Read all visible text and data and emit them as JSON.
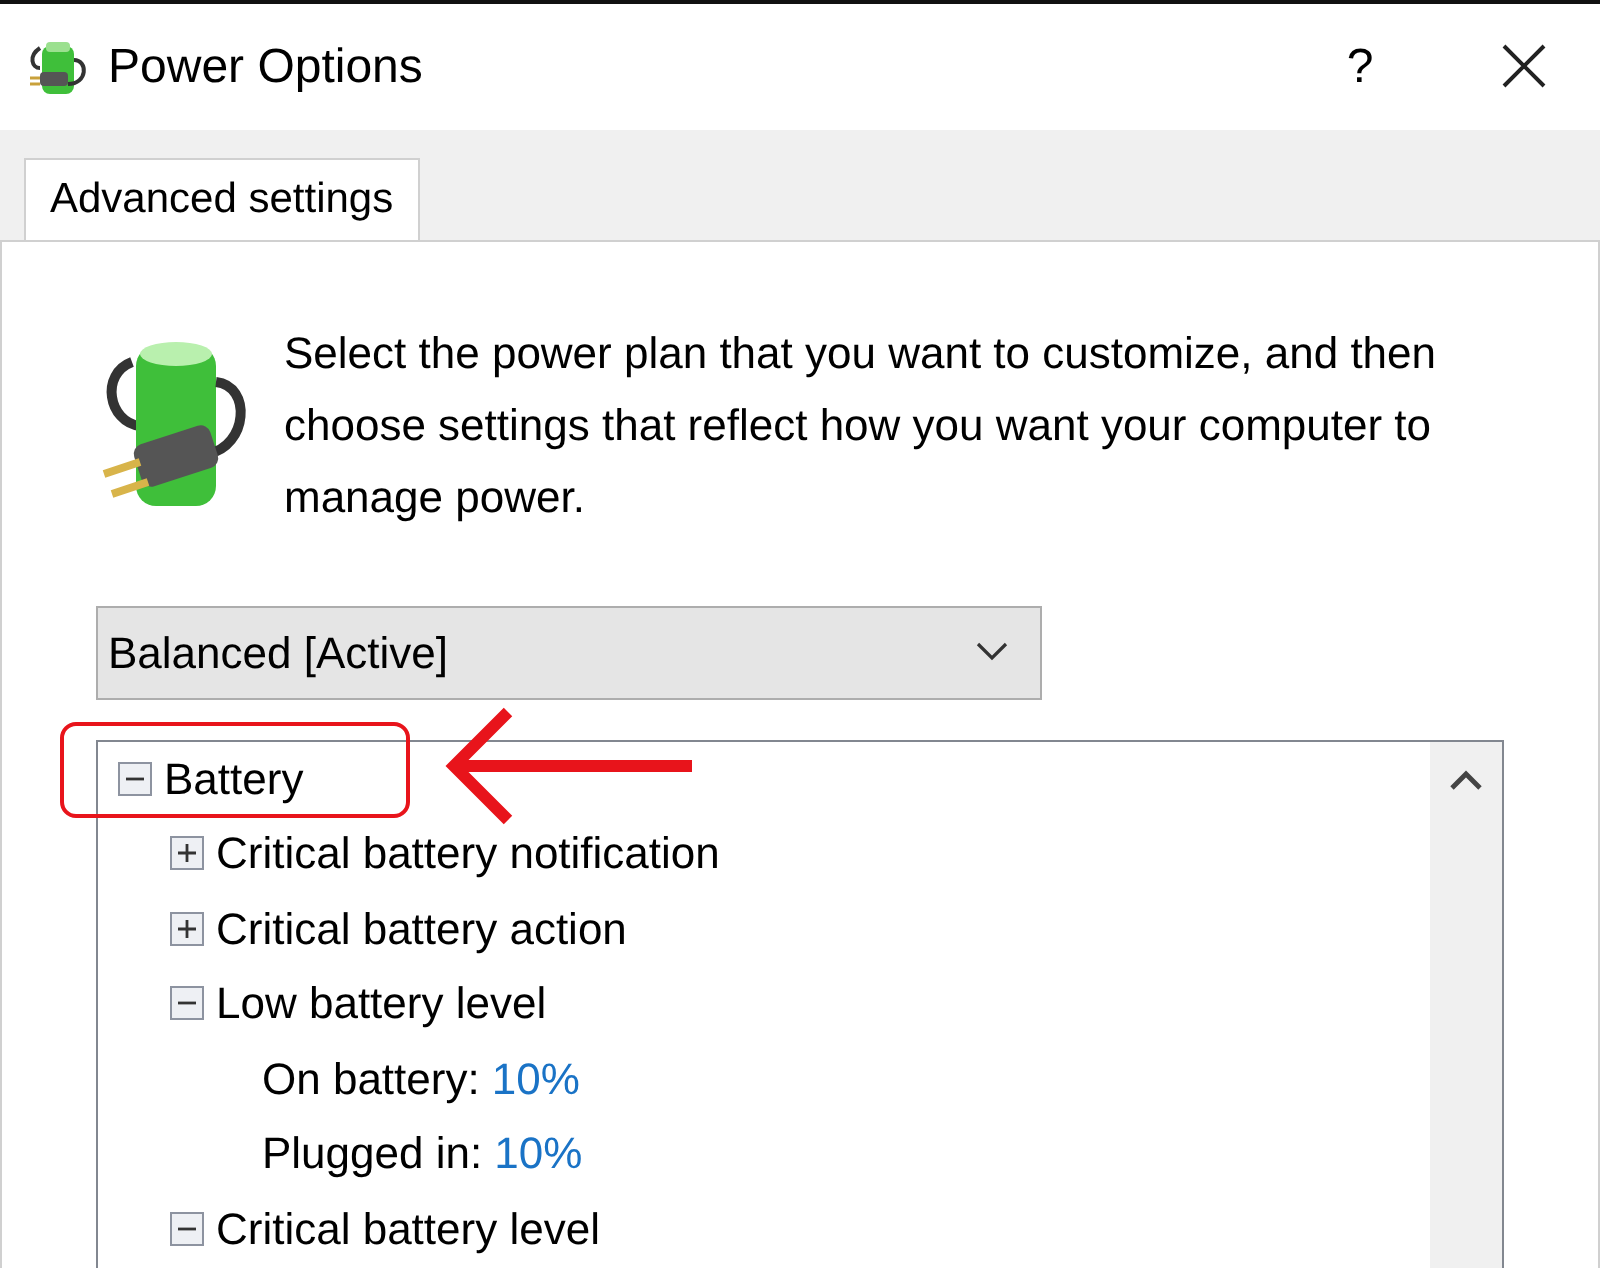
{
  "window": {
    "title": "Power Options",
    "help": "?"
  },
  "tabs": [
    {
      "label": "Advanced settings",
      "selected": true
    }
  ],
  "description": "Select the power plan that you want to customize, and then choose settings that reflect how you want your computer to manage power.",
  "plan": {
    "value": "Balanced [Active]"
  },
  "tree": [
    {
      "label": "Battery",
      "expanded": true,
      "annotated": true,
      "children": [
        {
          "label": "Critical battery notification",
          "expanded": false
        },
        {
          "label": "Critical battery action",
          "expanded": false
        },
        {
          "label": "Low battery level",
          "expanded": true,
          "children": [
            {
              "label": "On battery:",
              "value": "10%"
            },
            {
              "label": "Plugged in:",
              "value": "10%"
            }
          ]
        },
        {
          "label": "Critical battery level",
          "expanded": true
        }
      ]
    }
  ]
}
